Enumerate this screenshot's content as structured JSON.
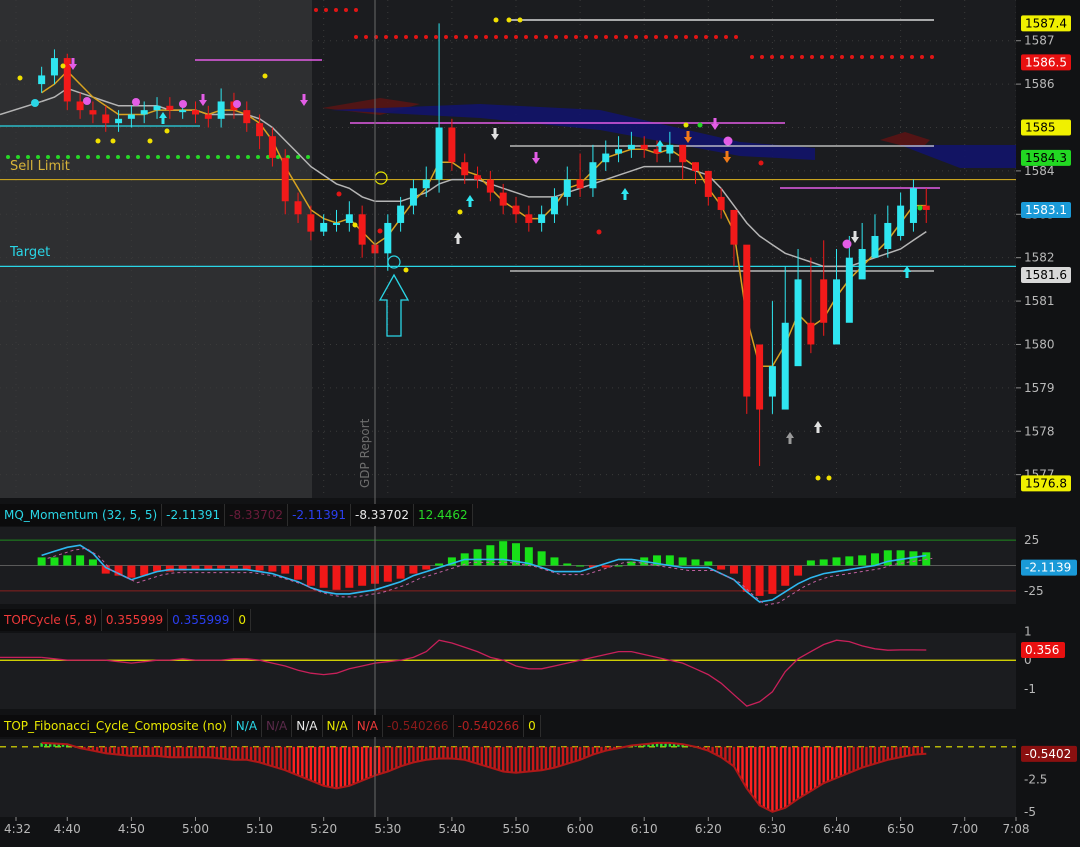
{
  "colors": {
    "bg": "#1b1c1f",
    "premarket_bg": "#2e2f31",
    "bull": "#2fe6f0",
    "bear": "#f21a1a",
    "grid": "#3a3a3a",
    "ma_gray": "#b5b5b5",
    "ma_gold": "#d8a320",
    "target_line": "#2ad6e6",
    "sell_limit_line": "#c8a21e",
    "magenta": "#e35de6",
    "red_dot": "#e01515",
    "green_dot": "#27d827",
    "yellow_dot": "#f0e000",
    "momentum_line": "#2eb8f0",
    "hist_green": "#18e018",
    "hist_red": "#f01818",
    "cycle_line": "#c8205a",
    "zero_line": "#e8e800"
  },
  "main": {
    "sell_limit_label": "Sell Limit",
    "target_label": "Target",
    "event_label": "GDP Report",
    "y_ticks": [
      "1587",
      "1586",
      "1584",
      "1583",
      "1582",
      "1581",
      "1580",
      "1579",
      "1578",
      "1577"
    ],
    "price_tags": {
      "p1587_4": "1587.4",
      "p1586_5": "1586.5",
      "p1585": "1585",
      "p1584_3": "1584.3",
      "p1583_1": "1583.1",
      "p1581_6": "1581.6",
      "p1576_8": "1576.8"
    }
  },
  "momentum": {
    "name": "MQ_Momentum (32, 5, 5)",
    "v1": "-2.11391",
    "v2": "-8.33702",
    "v3": "-2.11391",
    "v4": "-8.33702",
    "v5": "12.4462",
    "y_ticks": [
      "25",
      "-25"
    ],
    "tag": "-2.1139"
  },
  "topcycle": {
    "name": "TOPCycle (5, 8)",
    "v1": "0.355999",
    "v2": "0.355999",
    "v3": "0",
    "y_ticks": [
      "1",
      "0",
      "-1"
    ],
    "tag": "0.356"
  },
  "fib": {
    "name": "TOP_Fibonacci_Cycle_Composite (no)",
    "v1": "N/A",
    "v2": "N/A",
    "v3": "N/A",
    "v4": "N/A",
    "v5": "N/A",
    "v6": "-0.540266",
    "v7": "-0.540266",
    "v8": "0",
    "y_ticks": [
      "-2.5",
      "-5"
    ],
    "tag": "-0.5402"
  },
  "x_axis": {
    "labels": [
      "4:32",
      "4:40",
      "4:50",
      "5:00",
      "5:10",
      "5:20",
      "5:30",
      "5:40",
      "5:50",
      "6:00",
      "6:10",
      "6:20",
      "6:30",
      "6:40",
      "6:50",
      "7:00",
      "7:08"
    ]
  },
  "chart_data": [
    {
      "type": "candlestick",
      "x_unit": "time",
      "ylim": [
        1576.6,
        1587.8
      ],
      "times": [
        "4:36",
        "4:38",
        "4:40",
        "4:42",
        "4:44",
        "4:46",
        "4:48",
        "4:50",
        "4:52",
        "4:54",
        "4:56",
        "4:58",
        "5:00",
        "5:02",
        "5:04",
        "5:06",
        "5:08",
        "5:10",
        "5:12",
        "5:14",
        "5:16",
        "5:18",
        "5:20",
        "5:22",
        "5:24",
        "5:26",
        "5:28",
        "5:30",
        "5:32",
        "5:34",
        "5:36",
        "5:38",
        "5:40",
        "5:42",
        "5:44",
        "5:46",
        "5:48",
        "5:50",
        "5:52",
        "5:54",
        "5:56",
        "5:58",
        "6:00",
        "6:02",
        "6:04",
        "6:06",
        "6:08",
        "6:10",
        "6:12",
        "6:14",
        "6:16",
        "6:18",
        "6:20",
        "6:22",
        "6:24",
        "6:26",
        "6:28",
        "6:30",
        "6:32",
        "6:34",
        "6:36",
        "6:38",
        "6:40",
        "6:42",
        "6:44",
        "6:46",
        "6:48",
        "6:50",
        "6:52",
        "6:54"
      ],
      "open": [
        1586.0,
        1586.2,
        1586.6,
        1585.6,
        1585.4,
        1585.3,
        1585.1,
        1585.2,
        1585.3,
        1585.4,
        1585.5,
        1585.4,
        1585.4,
        1585.3,
        1585.2,
        1585.6,
        1585.4,
        1585.1,
        1584.8,
        1584.3,
        1583.3,
        1583.0,
        1582.6,
        1582.8,
        1582.8,
        1583.0,
        1582.3,
        1582.1,
        1582.8,
        1583.2,
        1583.6,
        1583.8,
        1585.0,
        1584.2,
        1583.9,
        1583.8,
        1583.5,
        1583.2,
        1583.0,
        1582.8,
        1583.0,
        1583.4,
        1583.8,
        1583.6,
        1584.2,
        1584.4,
        1584.5,
        1584.6,
        1584.5,
        1584.4,
        1584.6,
        1584.2,
        1584.0,
        1583.4,
        1583.1,
        1582.3,
        1580.0,
        1578.8,
        1578.5,
        1579.5,
        1580.5,
        1581.5,
        1580.0,
        1580.5,
        1581.5,
        1582.0,
        1582.2,
        1582.5,
        1582.8,
        1583.2
      ],
      "close": [
        1586.2,
        1586.6,
        1585.6,
        1585.4,
        1585.3,
        1585.1,
        1585.2,
        1585.3,
        1585.4,
        1585.5,
        1585.4,
        1585.4,
        1585.3,
        1585.2,
        1585.6,
        1585.4,
        1585.1,
        1584.8,
        1584.3,
        1583.3,
        1583.0,
        1582.6,
        1582.8,
        1582.8,
        1583.0,
        1582.3,
        1582.1,
        1582.8,
        1583.2,
        1583.6,
        1583.8,
        1585.0,
        1584.2,
        1583.9,
        1583.8,
        1583.5,
        1583.2,
        1583.0,
        1582.8,
        1583.0,
        1583.4,
        1583.8,
        1583.6,
        1584.2,
        1584.4,
        1584.5,
        1584.6,
        1584.5,
        1584.4,
        1584.6,
        1584.2,
        1584.0,
        1583.4,
        1583.1,
        1582.3,
        1578.8,
        1578.5,
        1579.5,
        1580.5,
        1581.5,
        1580.0,
        1580.5,
        1581.5,
        1582.0,
        1582.2,
        1582.5,
        1582.8,
        1583.2,
        1583.6,
        1583.1
      ],
      "high": [
        1586.4,
        1586.8,
        1586.7,
        1585.8,
        1585.6,
        1585.5,
        1585.4,
        1585.5,
        1585.6,
        1585.7,
        1585.7,
        1585.6,
        1585.6,
        1585.5,
        1585.9,
        1585.8,
        1585.6,
        1585.3,
        1585.0,
        1584.5,
        1583.5,
        1583.2,
        1583.0,
        1583.1,
        1583.3,
        1583.2,
        1582.6,
        1583.0,
        1583.4,
        1583.8,
        1584.1,
        1587.4,
        1585.2,
        1584.4,
        1584.1,
        1584.0,
        1583.7,
        1583.4,
        1583.2,
        1583.2,
        1583.6,
        1584.1,
        1584.4,
        1584.6,
        1584.7,
        1584.8,
        1584.9,
        1584.8,
        1584.7,
        1584.9,
        1584.6,
        1584.2,
        1584.0,
        1583.6,
        1582.6,
        1579.2,
        1579.6,
        1581.0,
        1581.8,
        1582.2,
        1582.0,
        1582.4,
        1582.2,
        1582.5,
        1582.8,
        1583.0,
        1583.2,
        1583.5,
        1583.8,
        1583.6
      ],
      "low": [
        1585.8,
        1586.0,
        1585.4,
        1585.2,
        1585.1,
        1584.9,
        1584.9,
        1585.0,
        1585.1,
        1585.2,
        1585.2,
        1585.2,
        1585.1,
        1585.0,
        1585.0,
        1585.2,
        1584.9,
        1584.5,
        1584.1,
        1583.0,
        1582.8,
        1582.4,
        1582.5,
        1582.6,
        1582.6,
        1582.0,
        1581.6,
        1581.7,
        1582.6,
        1583.0,
        1583.4,
        1583.5,
        1584.0,
        1583.7,
        1583.6,
        1583.3,
        1583.0,
        1582.8,
        1582.6,
        1582.6,
        1582.8,
        1583.2,
        1583.4,
        1583.4,
        1584.0,
        1584.2,
        1584.3,
        1584.3,
        1584.2,
        1584.2,
        1583.8,
        1583.7,
        1583.2,
        1582.9,
        1581.8,
        1578.4,
        1577.2,
        1578.4,
        1579.2,
        1580.2,
        1579.8,
        1580.2,
        1580.5,
        1581.2,
        1581.6,
        1582.0,
        1582.0,
        1582.4,
        1582.6,
        1582.8
      ],
      "ma_gray": [
        1585.6,
        1585.7,
        1585.9,
        1585.8,
        1585.7,
        1585.6,
        1585.5,
        1585.5,
        1585.5,
        1585.5,
        1585.4,
        1585.4,
        1585.4,
        1585.3,
        1585.3,
        1585.3,
        1585.3,
        1585.2,
        1585.0,
        1584.7,
        1584.4,
        1584.1,
        1583.9,
        1583.7,
        1583.6,
        1583.4,
        1583.3,
        1583.3,
        1583.3,
        1583.4,
        1583.5,
        1583.7,
        1583.8,
        1583.8,
        1583.8,
        1583.7,
        1583.6,
        1583.5,
        1583.4,
        1583.4,
        1583.4,
        1583.5,
        1583.6,
        1583.7,
        1583.8,
        1583.9,
        1584.0,
        1584.1,
        1584.1,
        1584.1,
        1584.1,
        1584.0,
        1583.9,
        1583.6,
        1583.2,
        1582.8,
        1582.5,
        1582.3,
        1582.1,
        1582.0,
        1581.9,
        1581.8,
        1581.8,
        1581.8,
        1581.9,
        1582.0,
        1582.1,
        1582.2,
        1582.4,
        1582.6
      ],
      "ma_gold": [
        1585.8,
        1586.0,
        1586.3,
        1586.0,
        1585.7,
        1585.5,
        1585.3,
        1585.3,
        1585.3,
        1585.4,
        1585.4,
        1585.4,
        1585.4,
        1585.3,
        1585.4,
        1585.4,
        1585.3,
        1585.1,
        1584.7,
        1584.1,
        1583.6,
        1583.1,
        1582.9,
        1582.8,
        1582.9,
        1582.6,
        1582.3,
        1582.5,
        1582.9,
        1583.3,
        1583.6,
        1584.2,
        1584.2,
        1584.0,
        1583.9,
        1583.6,
        1583.3,
        1583.1,
        1582.9,
        1582.9,
        1583.2,
        1583.6,
        1583.7,
        1584.0,
        1584.3,
        1584.4,
        1584.5,
        1584.5,
        1584.4,
        1584.5,
        1584.3,
        1584.1,
        1583.6,
        1583.2,
        1582.6,
        1580.6,
        1579.5,
        1579.5,
        1580.0,
        1580.7,
        1580.4,
        1580.6,
        1581.1,
        1581.5,
        1581.8,
        1582.1,
        1582.4,
        1582.8,
        1583.2,
        1583.2
      ],
      "levels": [
        {
          "name": "Sell Limit",
          "value": 1583.8
        },
        {
          "name": "Target",
          "value": 1581.8
        }
      ],
      "event": {
        "name": "GDP Report",
        "time": "5:30"
      }
    },
    {
      "type": "bar",
      "name": "MQ_Momentum (32, 5, 5)",
      "ylim": [
        -38,
        38
      ],
      "values": [
        8,
        8,
        10,
        10,
        6,
        -8,
        -10,
        -12,
        -10,
        -6,
        -6,
        -5,
        -4,
        -4,
        -3,
        -3,
        -4,
        -5,
        -6,
        -8,
        -14,
        -20,
        -22,
        -24,
        -22,
        -20,
        -18,
        -16,
        -13,
        -8,
        -4,
        2,
        8,
        12,
        16,
        20,
        24,
        22,
        18,
        14,
        8,
        2,
        0,
        -2,
        -2,
        0,
        4,
        8,
        10,
        10,
        8,
        6,
        4,
        -4,
        -8,
        -26,
        -30,
        -28,
        -20,
        -10,
        5,
        6,
        8,
        9,
        10,
        12,
        15,
        15,
        14,
        13
      ],
      "signal": [
        10,
        14,
        18,
        20,
        12,
        -2,
        -8,
        -14,
        -10,
        -6,
        -4,
        -4,
        -4,
        -4,
        -4,
        -4,
        -4,
        -6,
        -8,
        -12,
        -16,
        -22,
        -26,
        -28,
        -28,
        -26,
        -24,
        -20,
        -16,
        -10,
        -6,
        -2,
        2,
        6,
        6,
        6,
        6,
        4,
        2,
        -2,
        -6,
        -6,
        -6,
        -2,
        2,
        6,
        6,
        4,
        2,
        0,
        -2,
        -2,
        -2,
        -8,
        -14,
        -26,
        -36,
        -34,
        -26,
        -18,
        -12,
        -8,
        -6,
        -4,
        -2,
        0,
        4,
        6,
        8,
        10
      ],
      "levels": [
        25,
        -25
      ]
    },
    {
      "type": "line",
      "name": "TOPCycle (5, 8)",
      "ylim": [
        -1.7,
        0.95
      ],
      "values": [
        0.1,
        0.05,
        0.0,
        0.0,
        0.0,
        0.0,
        -0.05,
        -0.1,
        -0.05,
        0.0,
        0.0,
        0.05,
        0.0,
        0.0,
        0.0,
        0.05,
        0.05,
        0.0,
        -0.1,
        -0.2,
        -0.35,
        -0.45,
        -0.5,
        -0.45,
        -0.3,
        -0.2,
        -0.1,
        -0.05,
        0.0,
        0.1,
        0.3,
        0.7,
        0.6,
        0.45,
        0.3,
        0.1,
        0.0,
        -0.2,
        -0.3,
        -0.3,
        -0.2,
        -0.1,
        0.0,
        0.1,
        0.2,
        0.3,
        0.3,
        0.2,
        0.1,
        0.0,
        -0.1,
        -0.3,
        -0.5,
        -0.8,
        -1.2,
        -1.6,
        -1.45,
        -1.1,
        -0.4,
        0.05,
        0.3,
        0.55,
        0.7,
        0.65,
        0.5,
        0.4,
        0.35,
        0.36,
        0.36,
        0.356
      ]
    },
    {
      "type": "bar",
      "name": "TOP_Fibonacci_Cycle_Composite (no)",
      "ylim": [
        -5.4,
        0.6
      ],
      "values": [
        0.3,
        0.25,
        0.2,
        -0.1,
        -0.3,
        -0.5,
        -0.6,
        -0.7,
        -0.7,
        -0.7,
        -0.8,
        -0.8,
        -0.8,
        -0.8,
        -0.9,
        -1.0,
        -1.0,
        -1.2,
        -1.5,
        -1.8,
        -2.2,
        -2.6,
        -3.0,
        -3.2,
        -3.0,
        -2.6,
        -2.2,
        -1.9,
        -1.5,
        -1.2,
        -1.0,
        -0.9,
        -0.9,
        -1.0,
        -1.3,
        -1.6,
        -1.9,
        -2.0,
        -1.9,
        -1.8,
        -1.6,
        -1.3,
        -1.0,
        -0.6,
        -0.3,
        -0.1,
        0.1,
        0.2,
        0.3,
        0.3,
        0.2,
        0.0,
        -0.3,
        -0.8,
        -1.5,
        -3.2,
        -4.5,
        -5.0,
        -4.7,
        -4.0,
        -3.4,
        -2.8,
        -2.4,
        -2.0,
        -1.6,
        -1.3,
        -1.0,
        -0.8,
        -0.6,
        -0.54
      ]
    }
  ]
}
